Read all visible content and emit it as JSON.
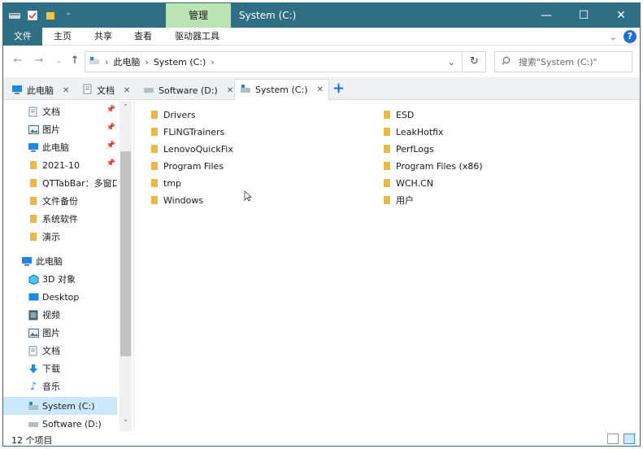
{
  "titlebar": {
    "manage_tab": "管理",
    "window_title": "System (C:)",
    "controls": {
      "minimize": "—",
      "maximize": "☐",
      "close": "✕"
    }
  },
  "ribbon": {
    "tabs": [
      "文件",
      "主页",
      "共享",
      "查看",
      "驱动器工具"
    ],
    "help": "?"
  },
  "address": {
    "path": [
      "此电脑",
      "System (C:)"
    ],
    "search_placeholder": "搜索\"System (C:)\""
  },
  "tabs": [
    {
      "label": "此电脑"
    },
    {
      "label": "文档"
    },
    {
      "label": "Software (D:)"
    },
    {
      "label": "System (C:)"
    }
  ],
  "navpane": {
    "quick_access": [
      {
        "label": "文档",
        "icon": "document-icon",
        "pinned": true
      },
      {
        "label": "图片",
        "icon": "picture-icon",
        "pinned": true
      },
      {
        "label": "此电脑",
        "icon": "computer-icon",
        "pinned": true
      },
      {
        "label": "2021-10",
        "icon": "folder-icon",
        "pinned": true
      },
      {
        "label": "QTTabBar：多窗口",
        "icon": "folder-icon",
        "pinned": false
      },
      {
        "label": "文件备份",
        "icon": "folder-icon",
        "pinned": false
      },
      {
        "label": "系统软件",
        "icon": "folder-icon",
        "pinned": false
      },
      {
        "label": "演示",
        "icon": "folder-icon",
        "pinned": false
      }
    ],
    "this_pc_label": "此电脑",
    "this_pc": [
      {
        "label": "3D 对象",
        "icon": "3d-objects-icon"
      },
      {
        "label": "Desktop",
        "icon": "desktop-icon"
      },
      {
        "label": "视频",
        "icon": "video-icon"
      },
      {
        "label": "图片",
        "icon": "picture-icon"
      },
      {
        "label": "文档",
        "icon": "document-icon"
      },
      {
        "label": "下载",
        "icon": "download-icon"
      },
      {
        "label": "音乐",
        "icon": "music-icon"
      },
      {
        "label": "System (C:)",
        "icon": "drive-c-icon",
        "selected": true
      },
      {
        "label": "Software (D:)",
        "icon": "drive-d-icon"
      }
    ]
  },
  "files": {
    "left": [
      "Drivers",
      "FLiNGTrainers",
      "LenovoQuickFix",
      "Program Files",
      "tmp",
      "Windows"
    ],
    "right": [
      "ESD",
      "LeakHotfix",
      "PerfLogs",
      "Program Files (x86)",
      "WCH.CN",
      "用户"
    ]
  },
  "status": {
    "item_count": "12 个项目"
  },
  "colors": {
    "accent": "#2f6f86",
    "manage": "#b9e3b2",
    "folder": "#e8b84a",
    "selected": "#cce8ff"
  }
}
